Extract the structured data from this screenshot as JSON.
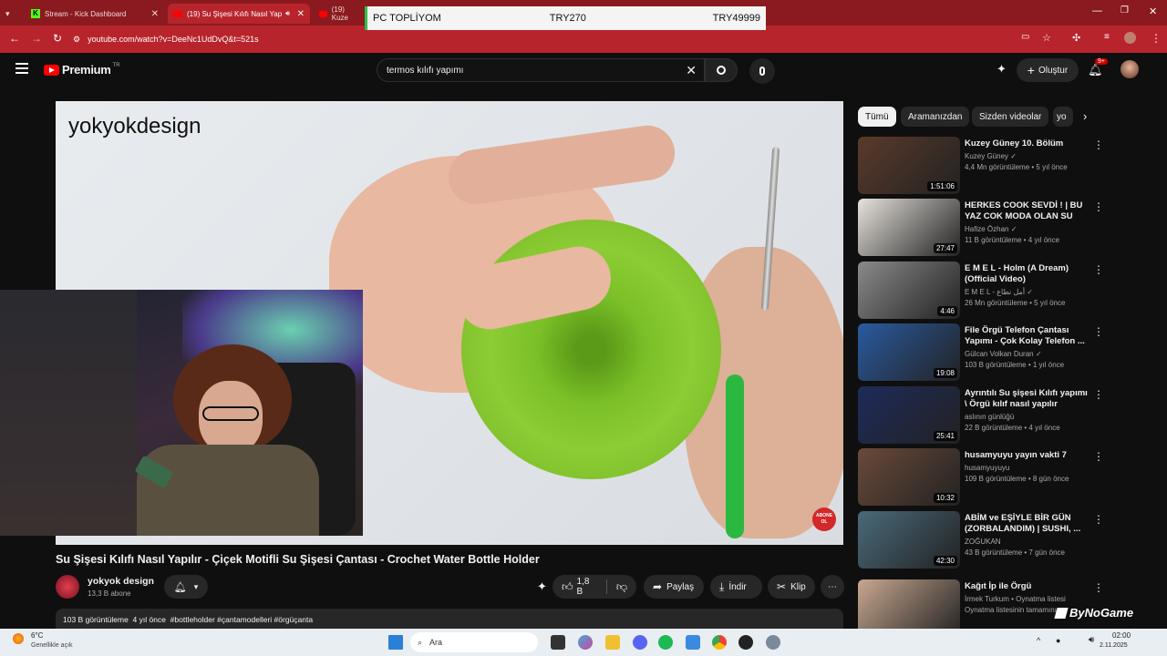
{
  "browser": {
    "tabs": [
      {
        "label": "Stream - Kick Dashboard"
      },
      {
        "label": "(19) Su Şişesi Kılıfı Nasıl Yapı"
      },
      {
        "label": "(19) Kuze"
      }
    ],
    "url": "youtube.com/watch?v=DeeNc1UdDvQ&t=521s"
  },
  "overlay": {
    "label": "PC TOPLİYOM",
    "current": "TRY270",
    "goal": "TRY49999"
  },
  "header": {
    "logo": "Premium",
    "logo_sup": "TR",
    "search_value": "termos kılıfı yapımı",
    "create_label": "Oluştur",
    "notif_count": "9+"
  },
  "video": {
    "watermark": "yokyokdesign",
    "subscribe_badge": "ABONE OL",
    "title": "Su Şişesi Kılıfı Nasıl Yapılır - Çiçek Motifli Su Şişesi Çantası - Crochet Water Bottle Holder",
    "channel": "yokyok design",
    "subscribers": "13,3 B abone",
    "likes": "1,8 B",
    "share_label": "Paylaş",
    "download_label": "İndir",
    "clip_label": "Klip",
    "description": "103 B görüntüleme  4 yıl önce  #bottleholder #çantamodelleri #örgüçanta"
  },
  "chips": [
    "Tümü",
    "Aramanızdan",
    "Sizden videolar",
    "yo"
  ],
  "recommendations": [
    {
      "title": "Kuzey Güney 10. Bölüm",
      "channel": "Kuzey Güney",
      "meta": "4,4 Mn görüntüleme • 5 yıl önce",
      "duration": "1:51:06",
      "verified": true,
      "thumb_color": "#5a3a2a"
    },
    {
      "title": "HERKES COOK SEVDİ ! | BU YAZ COK MODA OLAN SU ŞİŞESİ ...",
      "channel": "Hafize Özhan",
      "meta": "11 B görüntüleme • 4 yıl önce",
      "duration": "27:47",
      "verified": true,
      "thumb_color": "#e6e2dc"
    },
    {
      "title": "E M E L - Holm (A Dream) (Official Video)",
      "channel": "E M E L - أمل نطاع",
      "meta": "26 Mn görüntüleme • 5 yıl önce",
      "duration": "4:46",
      "verified": true,
      "thumb_color": "#8a8a8a"
    },
    {
      "title": "File Örgü Telefon Çantası Yapımı - Çok Kolay Telefon ...",
      "channel": "Gülcan Volkan Duran",
      "meta": "103 B görüntüleme • 1 yıl önce",
      "duration": "19:08",
      "verified": true,
      "thumb_color": "#2a5aa0"
    },
    {
      "title": "Ayrıntılı Su şişesi Kılıfı yapımı \\ Örgü kılıf nasıl yapılır",
      "channel": "aslının günlüğü",
      "meta": "22 B görüntüleme • 4 yıl önce",
      "duration": "25:41",
      "verified": false,
      "thumb_color": "#1e2a5a"
    },
    {
      "title": "husamyuyu yayın vakti 7",
      "channel": "husamyuyuyu",
      "meta": "109 B görüntüleme • 8 gün önce",
      "duration": "10:32",
      "verified": false,
      "thumb_color": "#6a4a3a"
    },
    {
      "title": "ABİM ve EŞİYLE BİR GÜN (ZORBALANDIM) | SUSHI, ...",
      "channel": "ZOĞUKAN",
      "meta": "43 B görüntüleme • 7 gün önce",
      "duration": "42:30",
      "verified": false,
      "thumb_color": "#4a6a7a"
    },
    {
      "title": "Kağıt İp ile Örgü",
      "channel": "İrmek Turkum • Oynatma listesi",
      "meta": "Oynatma listesinin tamamını",
      "duration": "",
      "verified": false,
      "thumb_color": "#c8a890"
    }
  ],
  "stream_watermark": "ByNoGame",
  "taskbar": {
    "weather_temp": "6°C",
    "weather_desc": "Genellikle açık",
    "search_label": "Ara",
    "time": "02:00",
    "date": "2.11.2025"
  }
}
